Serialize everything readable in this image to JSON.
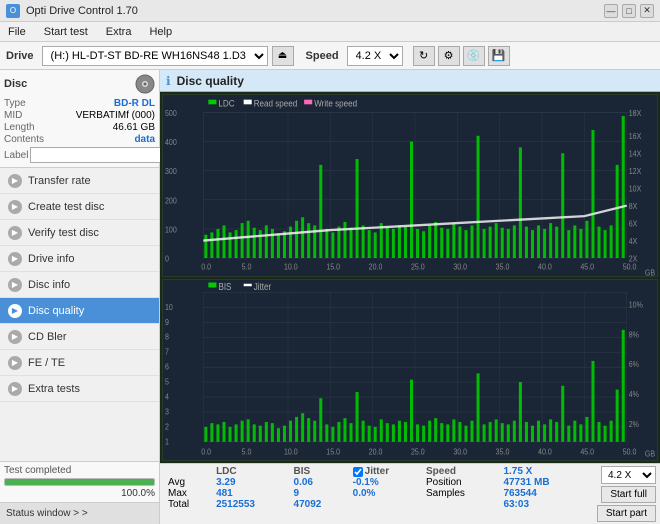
{
  "app": {
    "title": "Opti Drive Control 1.70",
    "icon": "O"
  },
  "titlebar": {
    "controls": [
      "—",
      "□",
      "✕"
    ]
  },
  "menubar": {
    "items": [
      "File",
      "Start test",
      "Extra",
      "Help"
    ]
  },
  "drivetoolbar": {
    "drive_label": "Drive",
    "drive_value": "(H:) HL-DT-ST BD-RE  WH16NS48 1.D3",
    "speed_label": "Speed",
    "speed_value": "4.2 X"
  },
  "disc": {
    "section_title": "Disc",
    "type_label": "Type",
    "type_value": "BD-R DL",
    "mid_label": "MID",
    "mid_value": "VERBATIMf (000)",
    "length_label": "Length",
    "length_value": "46.61 GB",
    "contents_label": "Contents",
    "contents_value": "data",
    "label_label": "Label",
    "label_placeholder": ""
  },
  "nav": {
    "items": [
      {
        "id": "transfer-rate",
        "label": "Transfer rate",
        "active": false
      },
      {
        "id": "create-test-disc",
        "label": "Create test disc",
        "active": false
      },
      {
        "id": "verify-test-disc",
        "label": "Verify test disc",
        "active": false
      },
      {
        "id": "drive-info",
        "label": "Drive info",
        "active": false
      },
      {
        "id": "disc-info",
        "label": "Disc info",
        "active": false
      },
      {
        "id": "disc-quality",
        "label": "Disc quality",
        "active": true
      },
      {
        "id": "cd-bler",
        "label": "CD Bler",
        "active": false
      },
      {
        "id": "fe-te",
        "label": "FE / TE",
        "active": false
      },
      {
        "id": "extra-tests",
        "label": "Extra tests",
        "active": false
      }
    ]
  },
  "status_window": {
    "label": "Status window > >"
  },
  "progress": {
    "value": 100,
    "label": "100.0%",
    "status_text": "Test completed"
  },
  "quality_panel": {
    "title": "Disc quality",
    "legend": {
      "ldc": "LDC",
      "read_speed": "Read speed",
      "write_speed": "Write speed",
      "bis": "BIS",
      "jitter": "Jitter"
    },
    "top_chart": {
      "y_max": 500,
      "y_right_max": 18,
      "x_max": 50,
      "x_ticks": [
        0,
        5,
        10,
        15,
        20,
        25,
        30,
        35,
        40,
        45,
        50
      ],
      "y_right_ticks": [
        2,
        4,
        6,
        8,
        10,
        12,
        14,
        16,
        18
      ],
      "y_left_ticks": [
        0,
        100,
        200,
        300,
        400,
        500
      ],
      "x_label": "GB"
    },
    "bottom_chart": {
      "y_max": 10,
      "y_right_max": 10,
      "x_max": 50,
      "x_ticks": [
        0,
        5,
        10,
        15,
        20,
        25,
        30,
        35,
        40,
        45,
        50
      ],
      "y_right_ticks": [
        "2%",
        "4%",
        "6%",
        "8%",
        "10%"
      ],
      "y_left_ticks": [
        1,
        2,
        3,
        4,
        5,
        6,
        7,
        8,
        9,
        10
      ],
      "x_label": "GB"
    }
  },
  "stats": {
    "columns": [
      "",
      "LDC",
      "BIS",
      "",
      "Jitter"
    ],
    "rows": [
      {
        "label": "Avg",
        "ldc": "3.29",
        "bis": "0.06",
        "jitter": "-0.1%"
      },
      {
        "label": "Max",
        "ldc": "481",
        "bis": "9",
        "jitter": "0.0%"
      },
      {
        "label": "Total",
        "ldc": "2512553",
        "bis": "47092",
        "jitter": ""
      }
    ],
    "speed_label": "Speed",
    "speed_value": "1.75 X",
    "position_label": "Position",
    "position_value": "47731 MB",
    "samples_label": "Samples",
    "samples_value": "763544",
    "speed_select": "4.2 X",
    "start_full": "Start full",
    "start_part": "Start part",
    "time": "63:03"
  }
}
